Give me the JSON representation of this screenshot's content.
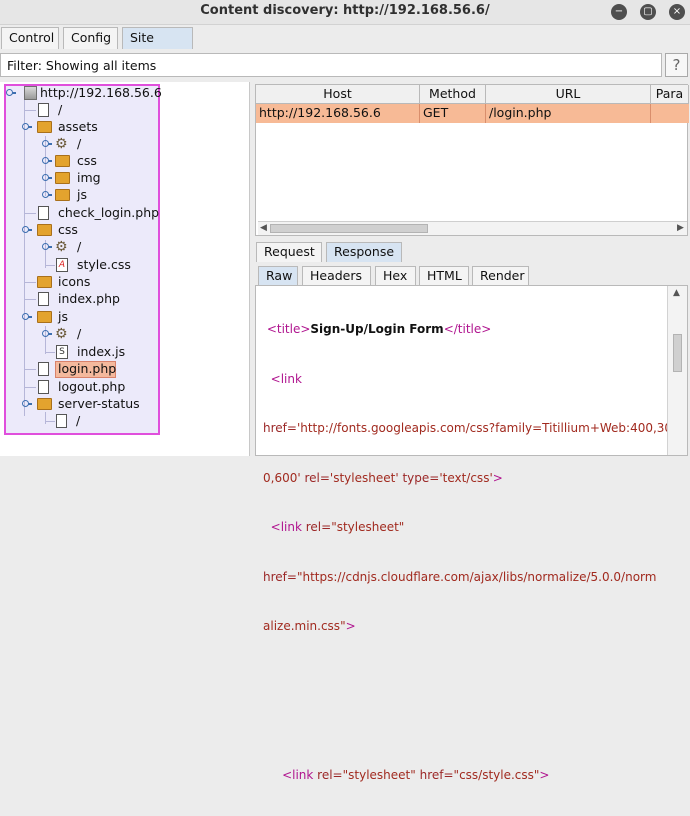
{
  "window": {
    "title": "Content discovery: http://192.168.56.6/",
    "minimize_icon": "minimize-icon",
    "maximize_icon": "maximize-icon",
    "close_icon": "close-icon"
  },
  "tabs": [
    {
      "label": "Control"
    },
    {
      "label": "Config"
    },
    {
      "label": "Site map",
      "active": true
    }
  ],
  "filter": {
    "text": "Filter: Showing all items",
    "help_label": "?"
  },
  "tree": {
    "root": "http://192.168.56.6",
    "nodes": [
      {
        "label": "/",
        "kind": "file"
      },
      {
        "label": "assets",
        "kind": "folder"
      },
      {
        "label": "/",
        "kind": "gear"
      },
      {
        "label": "css",
        "kind": "folder"
      },
      {
        "label": "img",
        "kind": "folder"
      },
      {
        "label": "js",
        "kind": "folder"
      },
      {
        "label": "check_login.php",
        "kind": "file"
      },
      {
        "label": "css",
        "kind": "folder"
      },
      {
        "label": "/",
        "kind": "gear"
      },
      {
        "label": "style.css",
        "kind": "css"
      },
      {
        "label": "icons",
        "kind": "folder"
      },
      {
        "label": "index.php",
        "kind": "file"
      },
      {
        "label": "js",
        "kind": "folder"
      },
      {
        "label": "/",
        "kind": "gear"
      },
      {
        "label": "index.js",
        "kind": "js"
      },
      {
        "label": "login.php",
        "kind": "file",
        "selected": true
      },
      {
        "label": "logout.php",
        "kind": "file"
      },
      {
        "label": "server-status",
        "kind": "folder"
      },
      {
        "label": "/",
        "kind": "file"
      }
    ]
  },
  "table": {
    "columns": [
      "Host",
      "Method",
      "URL",
      "Para"
    ],
    "rows": [
      {
        "host": "http://192.168.56.6",
        "method": "GET",
        "url": "/login.php"
      }
    ]
  },
  "message_tabs": [
    {
      "label": "Request"
    },
    {
      "label": "Response",
      "active": true
    }
  ],
  "view_tabs": [
    {
      "label": "Raw",
      "active": true
    },
    {
      "label": "Headers"
    },
    {
      "label": "Hex"
    },
    {
      "label": "HTML"
    },
    {
      "label": "Render"
    }
  ],
  "response": {
    "line1_tag_open": "<title>",
    "line1_text": "Sign-Up/Login Form",
    "line1_tag_close": "</title>",
    "line2_tag": "<link",
    "line3_attr": "href=",
    "line3_val": "'http://fonts.googleapis.com/css?family=Titillium+Web:400,30",
    "line4_val": "0,600'",
    "line4_attr_rel": " rel=",
    "line4_val_rel": "'stylesheet'",
    "line4_attr_type": " type=",
    "line4_val_type": "'text/css'",
    "line4_tag_end": ">",
    "line5_tag": "<link",
    "line5_attr": " rel=",
    "line5_val": "\"stylesheet\"",
    "line6_attr": "href=",
    "line6_val": "\"https://cdnjs.cloudflare.com/ajax/libs/normalize/5.0.0/norm",
    "line7_val": "alize.min.css\"",
    "line7_tag_end": ">",
    "line10_tag": "<link",
    "line10_attr_rel": " rel=",
    "line10_val_rel": "\"stylesheet\"",
    "line10_attr_href": " href=",
    "line10_val_href": "\"css/style.css\"",
    "line10_tag_end": ">"
  }
}
